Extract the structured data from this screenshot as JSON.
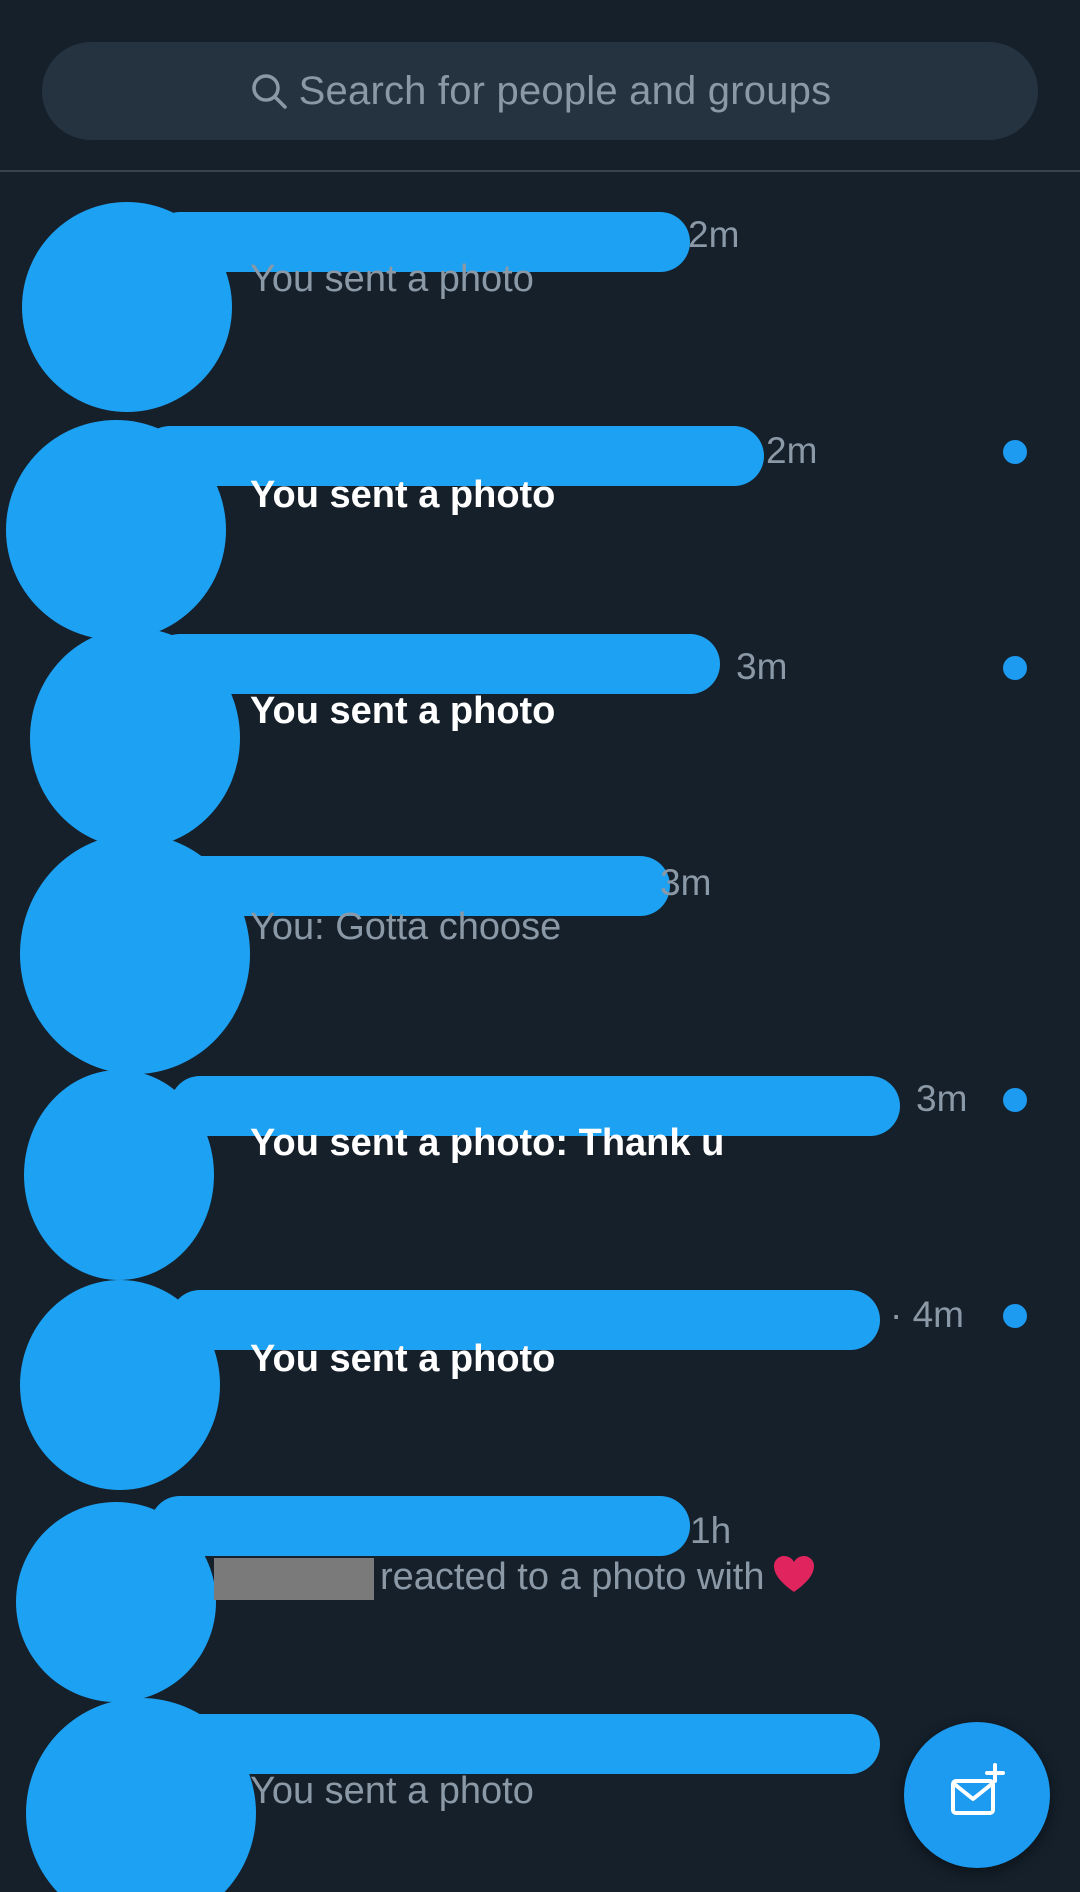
{
  "search": {
    "placeholder": "Search for people and groups",
    "icon": "search-icon"
  },
  "conversations": [
    {
      "time": "2m",
      "preview": "You sent a photo",
      "unread": false
    },
    {
      "time": "2m",
      "preview": "You sent a photo",
      "unread": true
    },
    {
      "time": "3m",
      "preview": "You sent a photo",
      "unread": true
    },
    {
      "time": "3m",
      "preview": "You: Gotta choose",
      "unread": false
    },
    {
      "time": "3m",
      "preview": "You sent a photo: Thank u",
      "unread": true
    },
    {
      "time": "· 4m",
      "preview": "You sent a photo",
      "unread": true
    },
    {
      "time": "1h",
      "preview": "reacted to a photo with",
      "reaction": "heart-icon",
      "unread": false
    },
    {
      "time": "",
      "preview": "You sent a photo",
      "unread": false
    }
  ],
  "compose": {
    "icon": "new-message-icon"
  },
  "colors": {
    "background": "#15202b",
    "accent": "#1d9bf0",
    "secondary_text": "#8b98a5",
    "heart": "#f91880"
  }
}
